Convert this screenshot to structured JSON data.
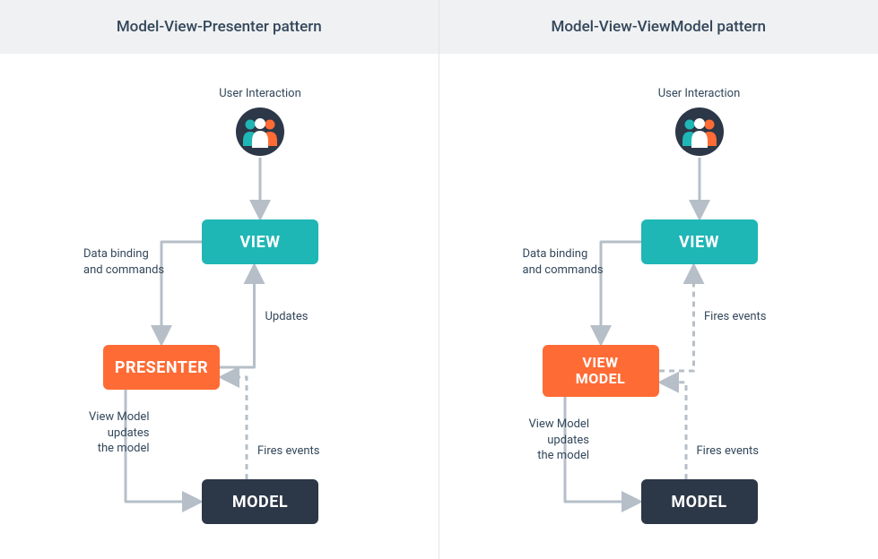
{
  "left": {
    "title": "Model-View-Presenter pattern",
    "user_label": "User Interaction",
    "view": "VIEW",
    "middle": "PRESENTER",
    "model": "MODEL",
    "lbl_binding": "Data binding\nand commands",
    "lbl_updates": "Updates",
    "lbl_vm_updates": "View Model\nupdates\nthe model",
    "lbl_fires": "Fires events"
  },
  "right": {
    "title": "Model-View-ViewModel pattern",
    "user_label": "User Interaction",
    "view": "VIEW",
    "middle": "VIEW\nMODEL",
    "model": "MODEL",
    "lbl_binding": "Data binding\nand commands",
    "lbl_updates": "Fires events",
    "lbl_vm_updates": "View Model\nupdates\nthe model",
    "lbl_fires": "Fires events"
  },
  "colors": {
    "arrow": "#b6bfc8",
    "teal": "#1fb6b6",
    "orange": "#ff6b35",
    "dark": "#2c3747"
  }
}
